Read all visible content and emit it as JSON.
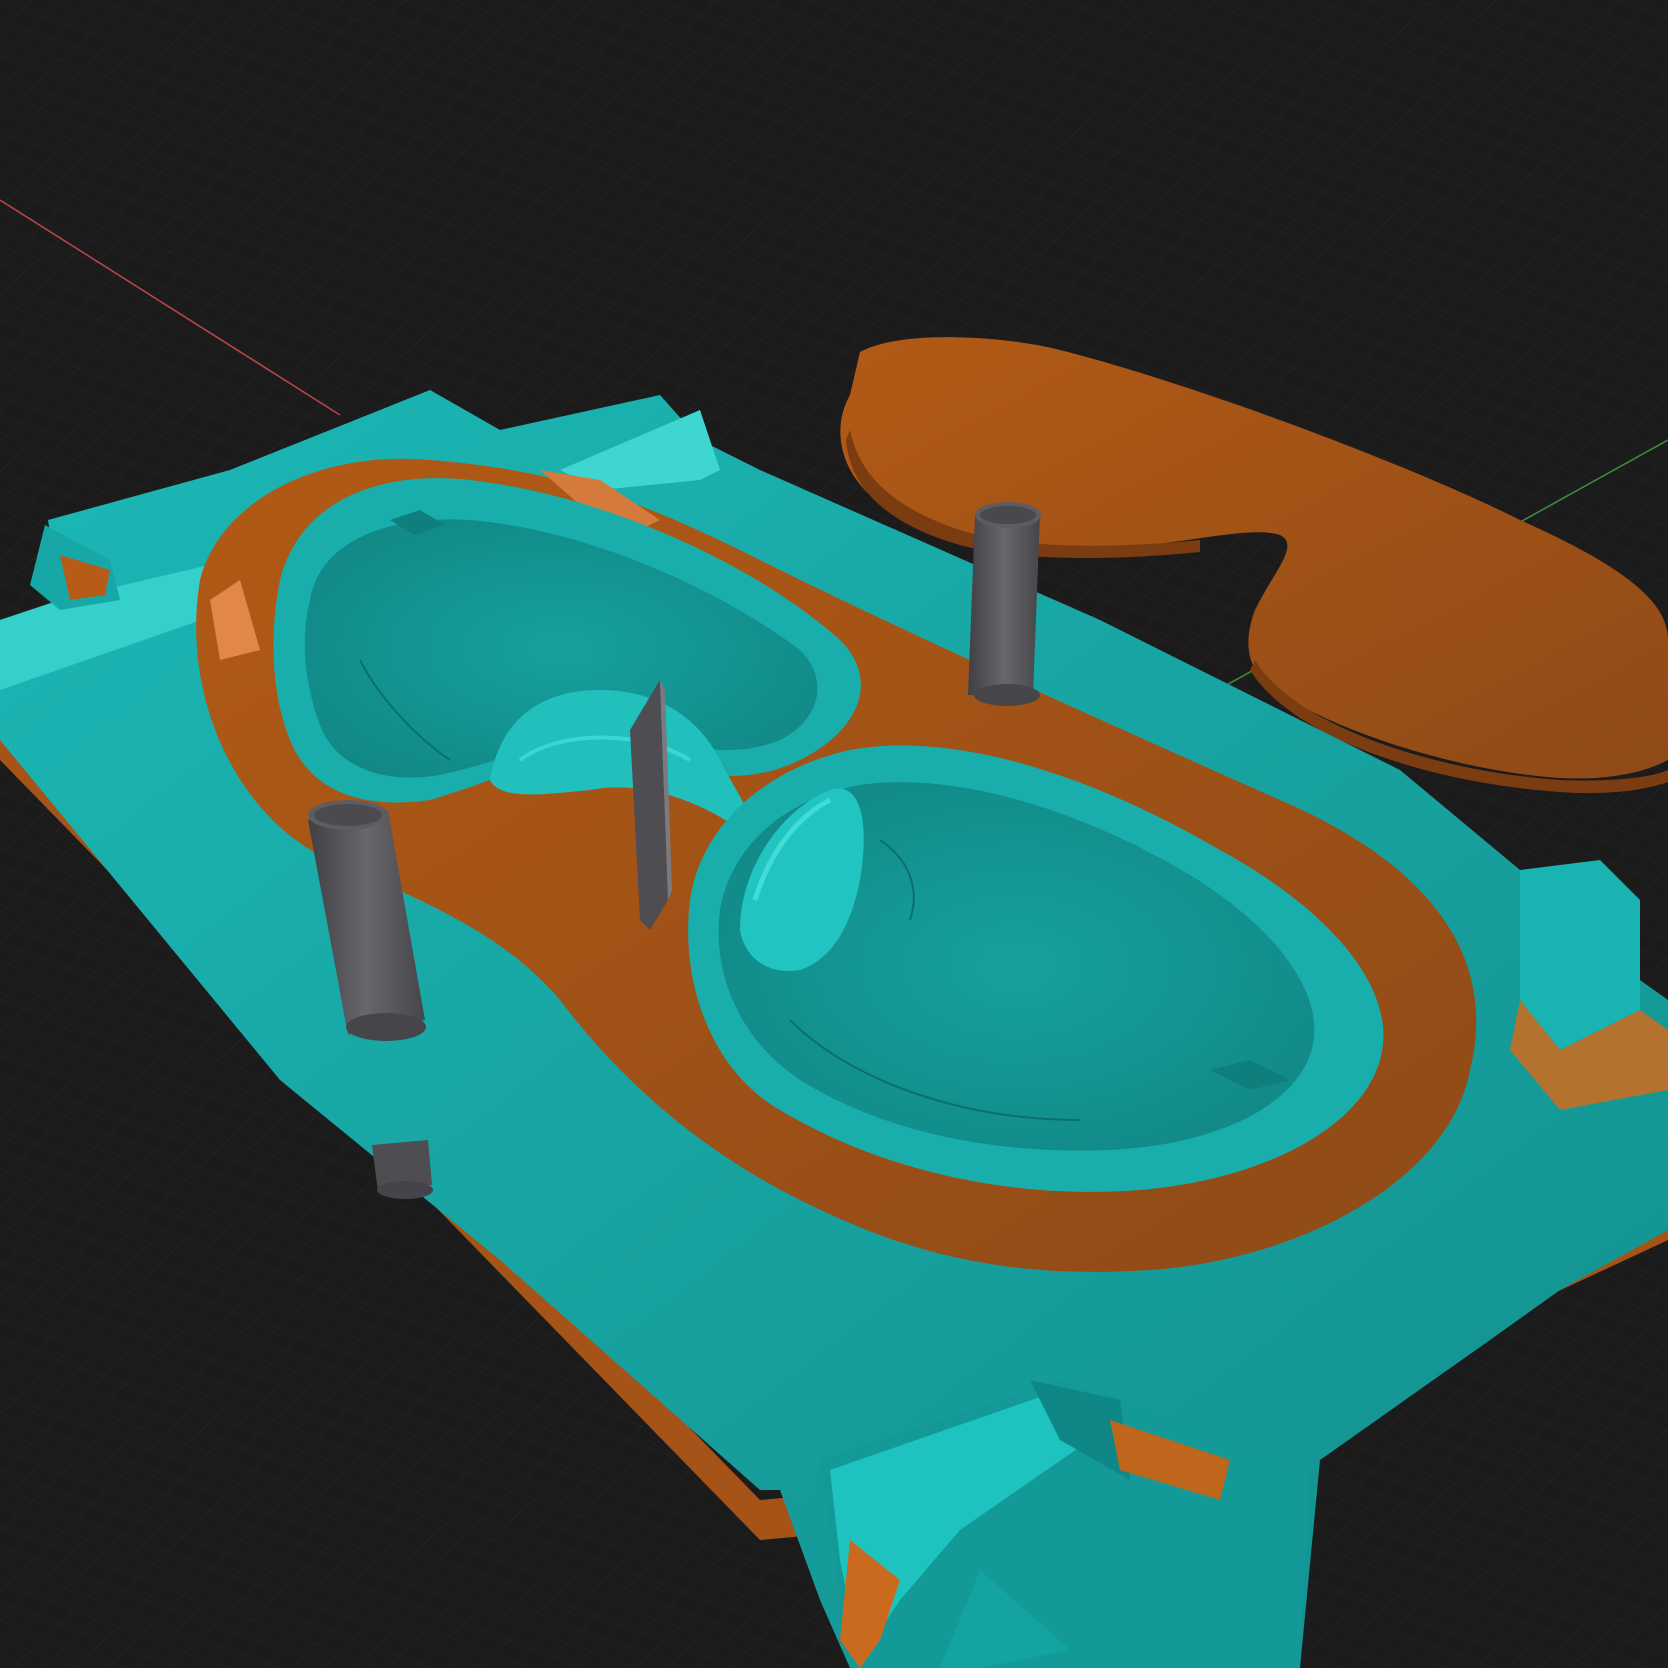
{
  "viewport": {
    "name": "3d-viewport",
    "background": "#1b1b1c",
    "grid_color": "#2a2a2c",
    "axis_x_color": "#b8434a",
    "axis_y_color": "#3a8d3a"
  },
  "scene": {
    "objects": [
      {
        "name": "mold-half-base",
        "color": "#14a6a6"
      },
      {
        "name": "gasket-part",
        "color": "#a85412"
      },
      {
        "name": "guide-pin-left",
        "color": "#55555a"
      },
      {
        "name": "guide-pin-right",
        "color": "#55555a"
      },
      {
        "name": "sprue-blade",
        "color": "#5a5a60"
      },
      {
        "name": "goggle-cavity-left",
        "color": "#17a3a3"
      },
      {
        "name": "goggle-cavity-right",
        "color": "#17a3a3"
      }
    ]
  }
}
